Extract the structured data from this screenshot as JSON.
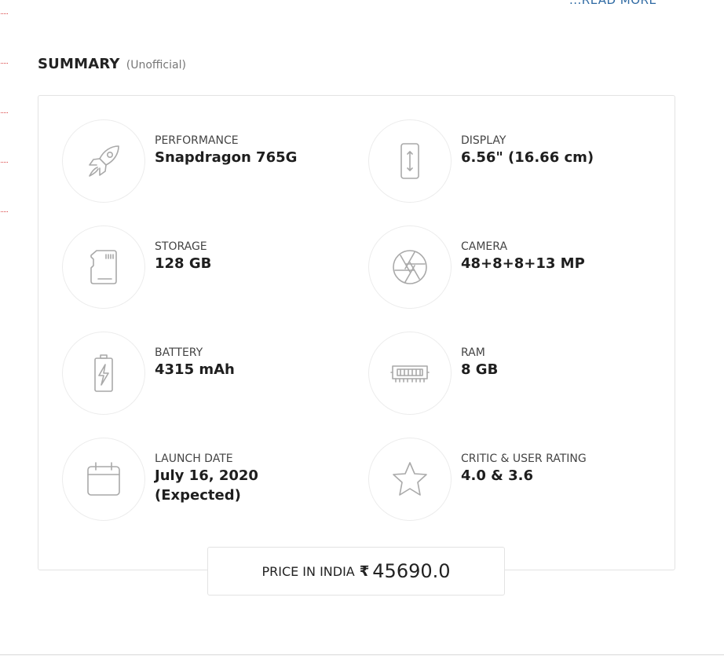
{
  "read_more": "...READ MORE",
  "summary": {
    "title": "SUMMARY",
    "subtitle": "(Unofficial)"
  },
  "specs": [
    {
      "icon": "rocket-icon",
      "label": "PERFORMANCE",
      "value": "Snapdragon 765G"
    },
    {
      "icon": "phone-display-icon",
      "label": "DISPLAY",
      "value": "6.56\" (16.66 cm)"
    },
    {
      "icon": "sd-card-icon",
      "label": "STORAGE",
      "value": "128 GB"
    },
    {
      "icon": "camera-aperture-icon",
      "label": "CAMERA",
      "value": "48+8+8+13 MP"
    },
    {
      "icon": "battery-icon",
      "label": "BATTERY",
      "value": "4315 mAh"
    },
    {
      "icon": "ram-chip-icon",
      "label": "RAM",
      "value": "8 GB"
    },
    {
      "icon": "calendar-icon",
      "label": "LAUNCH DATE",
      "value": "July 16, 2020",
      "value_line2": "(Expected)"
    },
    {
      "icon": "star-icon",
      "label": "CRITIC & USER RATING",
      "value": "4.0 & 3.6"
    }
  ],
  "price": {
    "label": "PRICE IN INDIA",
    "currency_symbol": "₹",
    "value": "45690.0"
  },
  "colors": {
    "link": "#2f6aa3",
    "icon_stroke": "#a9a9a9",
    "border": "#e3e3e3",
    "edge_marks": "#d94040"
  }
}
